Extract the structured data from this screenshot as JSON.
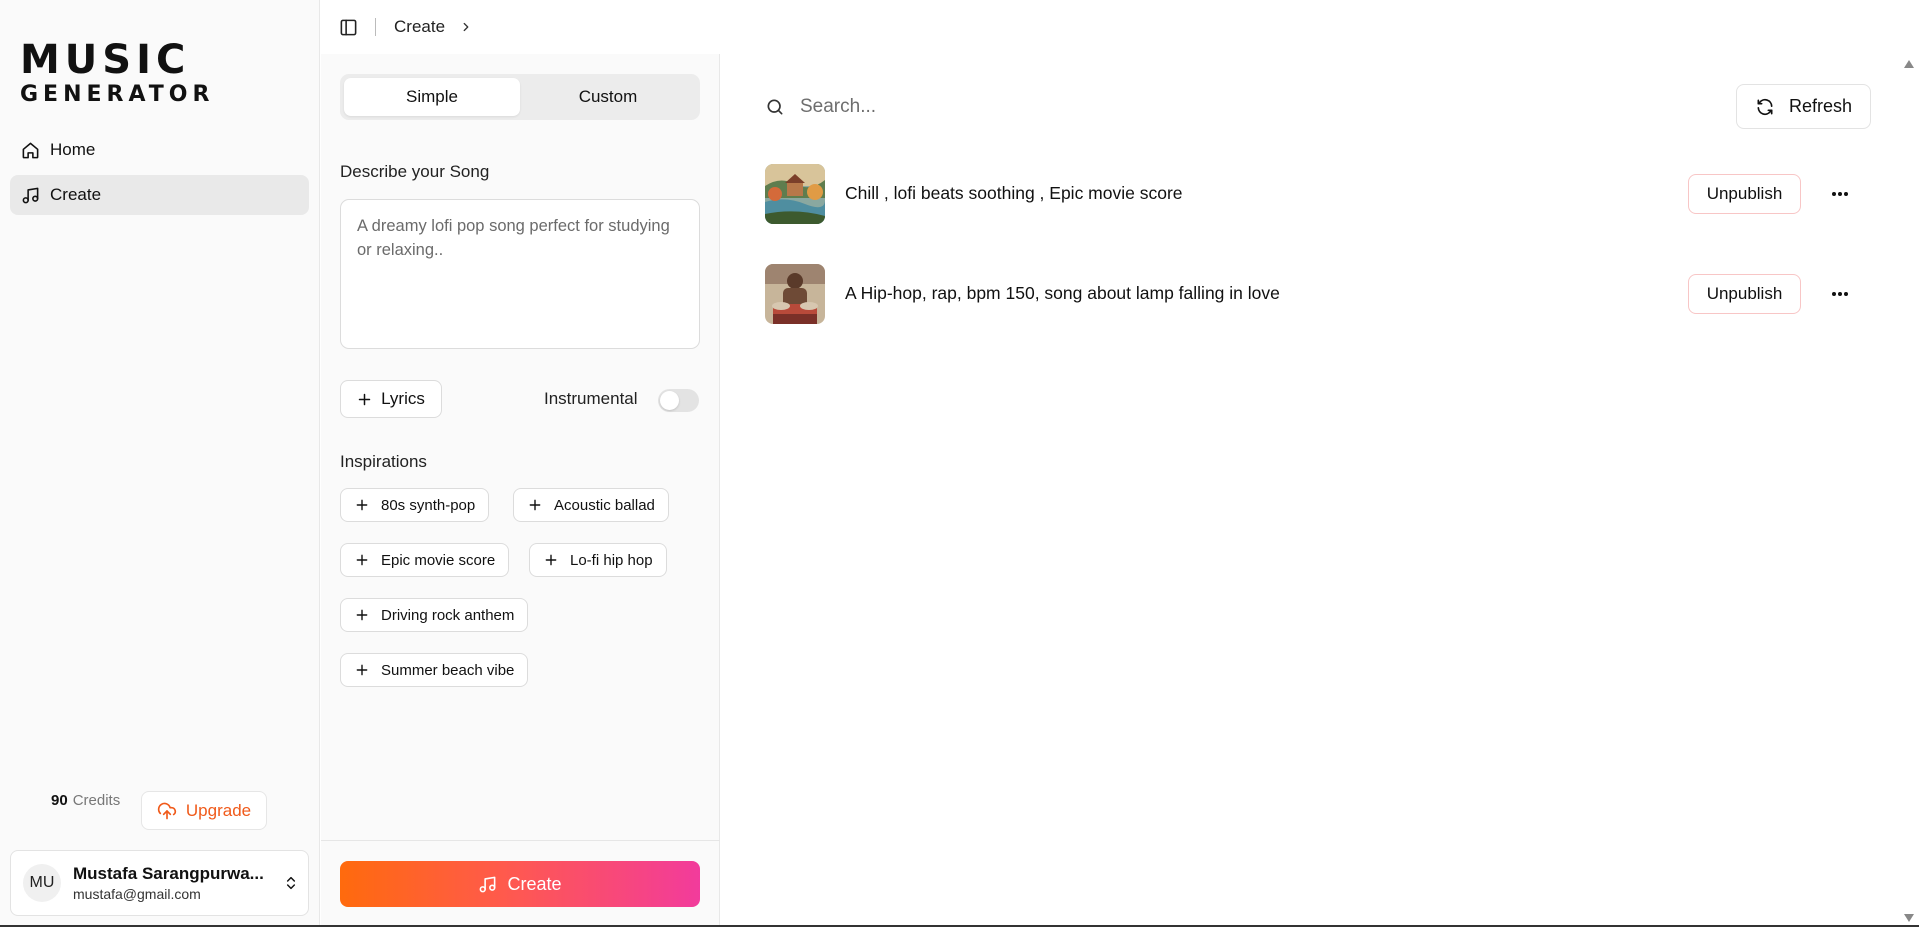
{
  "app": {
    "logo_line1": "MUSIC",
    "logo_line2": "GENERATOR"
  },
  "sidebar": {
    "items": [
      {
        "label": "Home",
        "icon": "home-icon",
        "active": false
      },
      {
        "label": "Create",
        "icon": "music-note-icon",
        "active": true
      }
    ],
    "credits_count": "90",
    "credits_label": "Credits",
    "upgrade_label": "Upgrade",
    "user": {
      "initials": "MU",
      "name": "Mustafa Sarangpurwa...",
      "email": "mustafa@gmail.com"
    }
  },
  "topbar": {
    "breadcrumb": "Create"
  },
  "create_panel": {
    "tabs": [
      {
        "label": "Simple",
        "active": true
      },
      {
        "label": "Custom",
        "active": false
      }
    ],
    "describe_label": "Describe your Song",
    "describe_placeholder": "A dreamy lofi pop song perfect for studying or relaxing..",
    "lyrics_label": "Lyrics",
    "instrumental_label": "Instrumental",
    "instrumental_on": false,
    "inspirations_label": "Inspirations",
    "inspirations": [
      "80s synth-pop",
      "Acoustic ballad",
      "Epic movie score",
      "Lo-fi hip hop",
      "Driving rock anthem",
      "Summer beach vibe"
    ],
    "create_label": "Create"
  },
  "content": {
    "search_placeholder": "Search...",
    "refresh_label": "Refresh",
    "songs": [
      {
        "title": "Chill , lofi beats soothing , Epic movie score",
        "action": "Unpublish"
      },
      {
        "title": "A Hip-hop, rap, bpm 150, song about lamp falling in love",
        "action": "Unpublish"
      }
    ]
  },
  "colors": {
    "accent_orange": "#f05a1a",
    "gradient_start": "#ff6a0d",
    "gradient_end": "#f23b9c",
    "unpublish_border": "#f8c6c6"
  }
}
